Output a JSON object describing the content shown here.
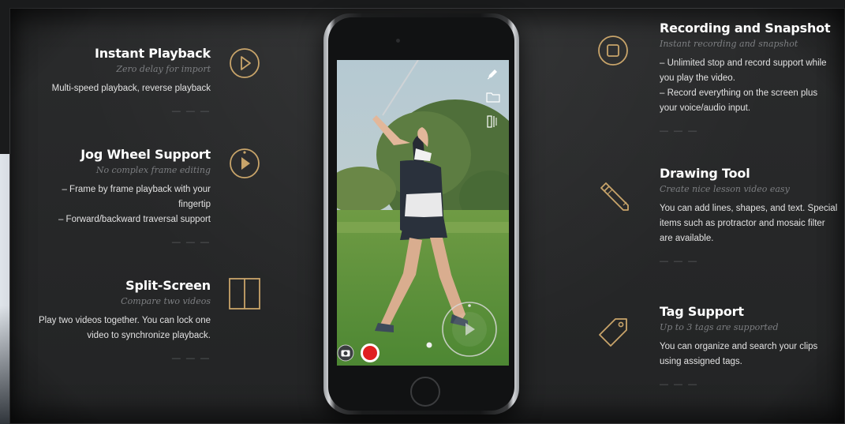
{
  "features_left": [
    {
      "title": "Instant Playback",
      "subtitle": "Zero delay for import",
      "description": [
        "Multi-speed playback, reverse playback"
      ],
      "divider": "— — —",
      "icon": "play-circle-icon"
    },
    {
      "title": "Jog Wheel Support",
      "subtitle": "No complex frame editing",
      "description": [
        "– Frame by frame playback with your",
        "fingertip",
        "– Forward/backward traversal support"
      ],
      "divider": "— — —",
      "icon": "jog-wheel-icon"
    },
    {
      "title": "Split-Screen",
      "subtitle": "Compare two videos",
      "description": [
        "Play two videos together. You can lock one",
        "video to synchronize playback."
      ],
      "divider": "— — —",
      "icon": "split-screen-icon"
    }
  ],
  "features_right": [
    {
      "title": "Recording and Snapshot",
      "subtitle": "Instant recording and snapshot",
      "description": [
        "– Unlimited stop and record support while",
        "you play the video.",
        "– Record everything on the screen plus",
        "your voice/audio input."
      ],
      "divider": "— — —",
      "icon": "record-stop-icon"
    },
    {
      "title": "Drawing Tool",
      "subtitle": "Create nice lesson video easy",
      "description": [
        "You can add lines, shapes, and text. Special",
        "items such as protractor and mosaic filter",
        "are available."
      ],
      "divider": "— — —",
      "icon": "pencil-icon"
    },
    {
      "title": "Tag Support",
      "subtitle": "Up to 3 tags are supported",
      "description": [
        "You can organize and search your clips",
        "using assigned tags."
      ],
      "divider": "— — —",
      "icon": "tag-icon"
    }
  ],
  "colors": {
    "accent_gold": "#c8a46a",
    "background": "#262728",
    "record_red": "#e02020"
  },
  "phone_screen_icons": [
    "pen-icon",
    "folder-icon",
    "split-view-icon",
    "camera-icon",
    "record-button-icon",
    "jog-play-icon"
  ]
}
